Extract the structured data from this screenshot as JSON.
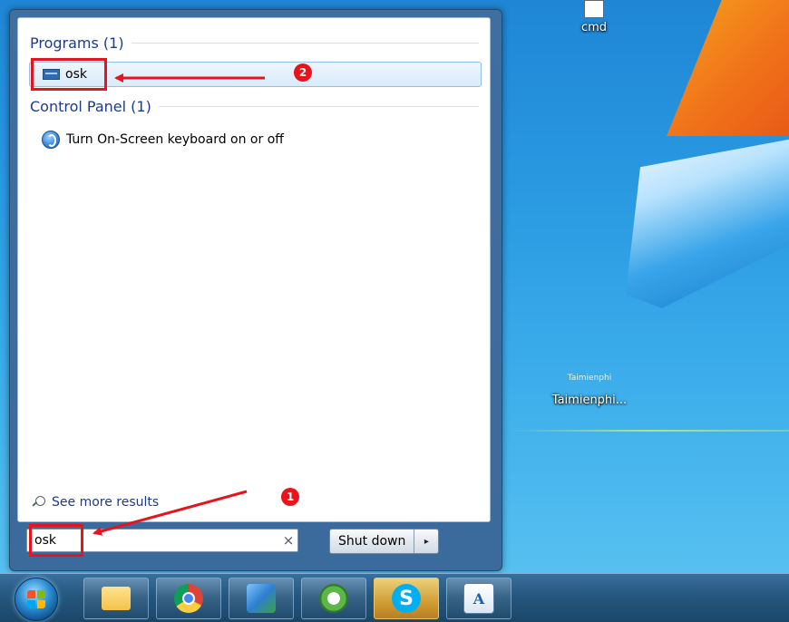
{
  "desktop": {
    "icons": [
      {
        "label": "cmd"
      },
      {
        "label": "Taimienphi...",
        "small_label": "Taimienphi"
      }
    ]
  },
  "start_menu": {
    "programs_header": "Programs (1)",
    "program_item": "osk",
    "control_panel_header": "Control Panel (1)",
    "control_panel_item": "Turn On-Screen keyboard on or off",
    "see_more": "See more results",
    "search": {
      "value": "osk",
      "clear_glyph": "×"
    },
    "shutdown_label": "Shut down",
    "shutdown_arrow_glyph": "▸"
  },
  "annotations": {
    "step1": "1",
    "step2": "2",
    "color": "#e8141b"
  },
  "taskbar": {
    "buttons": [
      {
        "icon": "folder-icon"
      },
      {
        "icon": "chrome-icon"
      },
      {
        "icon": "paint-icon"
      },
      {
        "icon": "coccoc-icon"
      },
      {
        "icon": "skype-icon",
        "glyph": "S"
      },
      {
        "icon": "wordpad-icon",
        "glyph": "A"
      }
    ]
  }
}
